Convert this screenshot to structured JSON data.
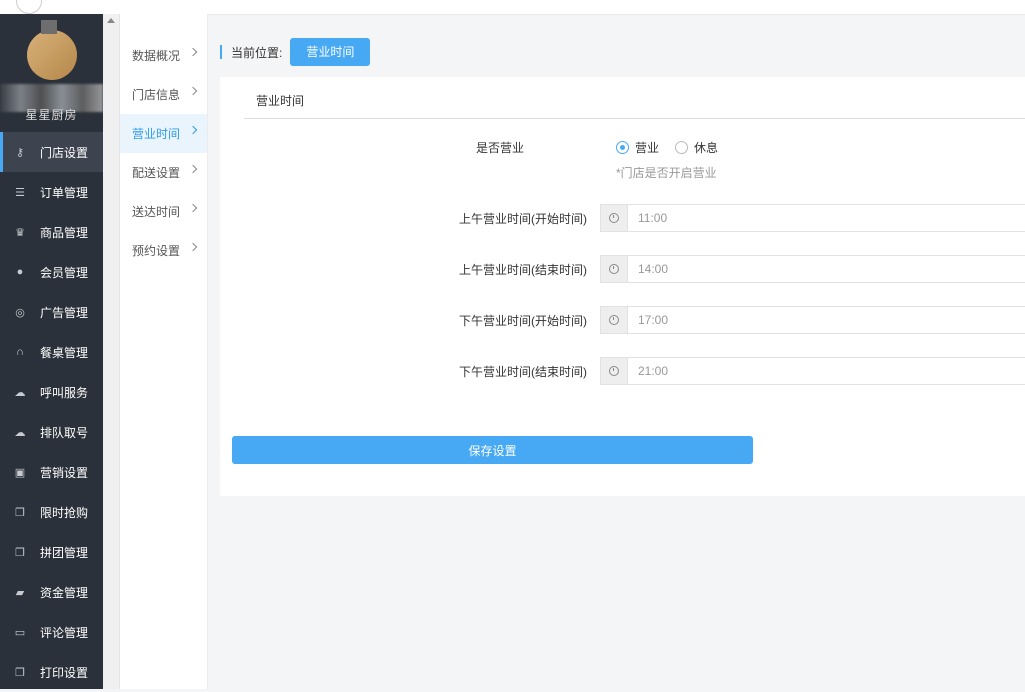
{
  "sidebar": {
    "shop_name": "星星厨房",
    "items": [
      {
        "label": "门店设置",
        "icon": "key-icon",
        "glyph": "⚷",
        "active": true
      },
      {
        "label": "订单管理",
        "icon": "list-icon",
        "glyph": "☰"
      },
      {
        "label": "商品管理",
        "icon": "trophy-icon",
        "glyph": "♛"
      },
      {
        "label": "会员管理",
        "icon": "user-icon",
        "glyph": "●"
      },
      {
        "label": "广告管理",
        "icon": "lifebuoy-icon",
        "glyph": "◎"
      },
      {
        "label": "餐桌管理",
        "icon": "binoculars-icon",
        "glyph": "∩"
      },
      {
        "label": "呼叫服务",
        "icon": "cloud-icon",
        "glyph": "☁"
      },
      {
        "label": "排队取号",
        "icon": "cloud-icon",
        "glyph": "☁"
      },
      {
        "label": "营销设置",
        "icon": "gift-icon",
        "glyph": "▣"
      },
      {
        "label": "限时抢购",
        "icon": "copy-icon",
        "glyph": "❐"
      },
      {
        "label": "拼团管理",
        "icon": "copy-icon",
        "glyph": "❐"
      },
      {
        "label": "资金管理",
        "icon": "book-icon",
        "glyph": "▰"
      },
      {
        "label": "评论管理",
        "icon": "money-icon",
        "glyph": "▭"
      },
      {
        "label": "打印设置",
        "icon": "copy-icon",
        "glyph": "❐"
      }
    ]
  },
  "submenu": {
    "items": [
      {
        "label": "数据概况"
      },
      {
        "label": "门店信息"
      },
      {
        "label": "营业时间",
        "active": true
      },
      {
        "label": "配送设置"
      },
      {
        "label": "送达时间"
      },
      {
        "label": "预约设置"
      }
    ]
  },
  "breadcrumb": {
    "label": "当前位置:",
    "current": "营业时间"
  },
  "panel": {
    "title": "营业时间",
    "open_label": "是否营业",
    "radio_open": "营业",
    "radio_rest": "休息",
    "hint": "*门店是否开启营业",
    "fields": [
      {
        "label": "上午营业时间(开始时间)",
        "value": "11:00"
      },
      {
        "label": "上午营业时间(结束时间)",
        "value": "14:00"
      },
      {
        "label": "下午营业时间(开始时间)",
        "value": "17:00"
      },
      {
        "label": "下午营业时间(结束时间)",
        "value": "21:00"
      }
    ],
    "save_label": "保存设置"
  }
}
